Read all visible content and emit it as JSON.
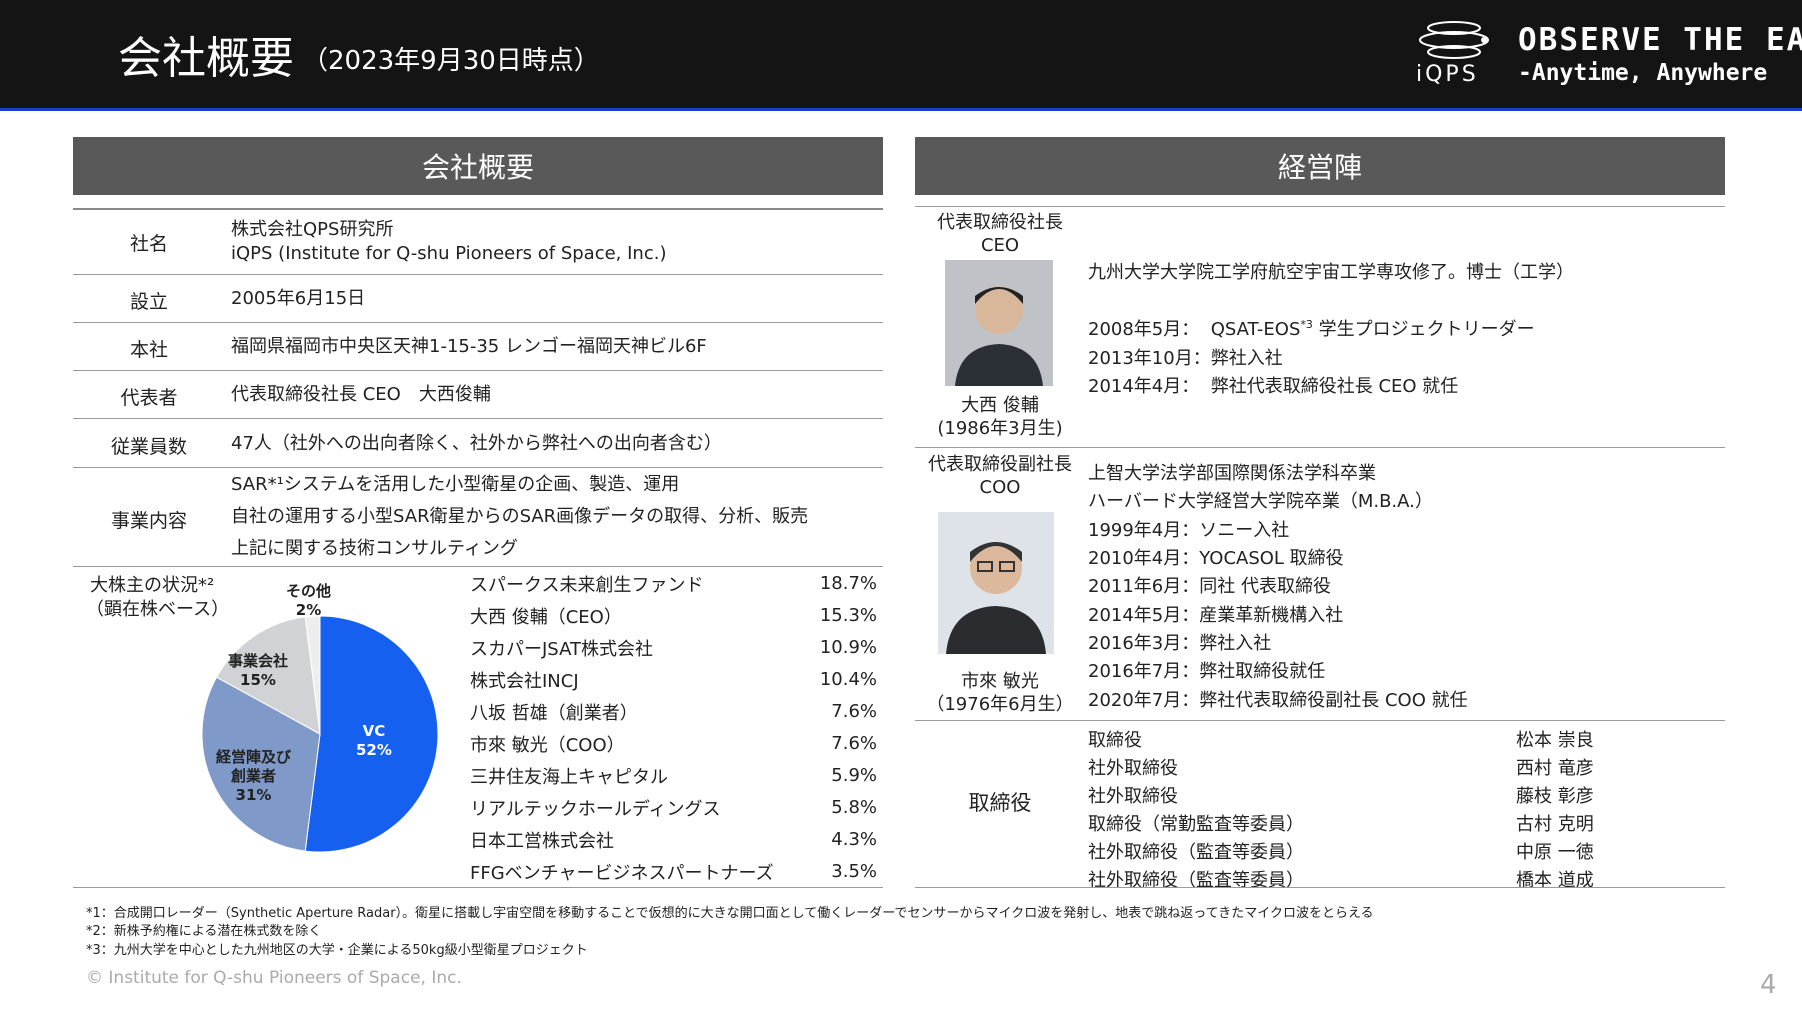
{
  "header": {
    "title": "会社概要",
    "subtitle": "（2023年9月30日時点）",
    "logo_text": "iQPS",
    "slogan_line1": "OBSERVE THE EARTH",
    "slogan_line2": "-Anytime, Anywhere"
  },
  "overview": {
    "heading": "会社概要",
    "rows": [
      {
        "label": "社名",
        "lines": [
          "株式会社QPS研究所",
          "iQPS (Institute for Q-shu Pioneers of Space, Inc.)"
        ]
      },
      {
        "label": "設立",
        "lines": [
          "2005年6月15日"
        ]
      },
      {
        "label": "本社",
        "lines": [
          "福岡県福岡市中央区天神1-15-35 レンゴー福岡天神ビル6F"
        ]
      },
      {
        "label": "代表者",
        "lines": [
          "代表取締役社長 CEO　大西俊輔"
        ]
      },
      {
        "label": "従業員数",
        "lines": [
          "47人（社外への出向者除く、社外から弊社への出向者含む）"
        ]
      },
      {
        "label": "事業内容",
        "lines": [
          "SAR*¹システムを活用した小型衛星の企画、製造、運用",
          "自社の運用する小型SAR衛星からのSAR画像データの取得、分析、販売",
          "上記に関する技術コンサルティング"
        ]
      }
    ]
  },
  "shareholders": {
    "title_line1": "大株主の状況*²",
    "title_line2": "（顕在株ベース）",
    "list": [
      {
        "name": "スパークス未来創生ファンド",
        "pct": "18.7%"
      },
      {
        "name": "大西 俊輔（CEO）",
        "pct": "15.3%"
      },
      {
        "name": "スカパーJSAT株式会社",
        "pct": "10.9%"
      },
      {
        "name": "株式会社INCJ",
        "pct": "10.4%"
      },
      {
        "name": "八坂 哲雄（創業者）",
        "pct": "7.6%"
      },
      {
        "name": "市來 敏光（COO）",
        "pct": "7.6%"
      },
      {
        "name": "三井住友海上キャピタル",
        "pct": "5.9%"
      },
      {
        "name": "リアルテックホールディングス",
        "pct": "5.8%"
      },
      {
        "name": "日本工営株式会社",
        "pct": "4.3%"
      },
      {
        "name": "FFGベンチャービジネスパートナーズ",
        "pct": "3.5%"
      }
    ]
  },
  "chart_data": {
    "type": "pie",
    "slices": [
      {
        "label": "VC",
        "pct_label": "52%",
        "value": 52,
        "color": "#1660f0"
      },
      {
        "label": "経営陣及び\n創業者",
        "pct_label": "31%",
        "value": 31,
        "color": "#7f99c9"
      },
      {
        "label": "事業会社",
        "pct_label": "15%",
        "value": 15,
        "color": "#d0d2d6"
      },
      {
        "label": "その他",
        "pct_label": "2%",
        "value": 2,
        "color": "#eeeeee"
      }
    ]
  },
  "management": {
    "heading": "経営陣",
    "ceo": {
      "role_line1": "代表取締役社長",
      "role_line2": "CEO",
      "name": "大西 俊輔",
      "birth": "(1986年3月生)",
      "bio_line1": "九州大学大学院工学府航空宇宙工学専攻修了。博士（工学）",
      "history": [
        {
          "date": "2008年5月：",
          "text": "QSAT-EOS",
          "sup": "*3",
          "text2": " 学生プロジェクトリーダー"
        },
        {
          "date": "2013年10月：",
          "text": "弊社入社",
          "sup": "",
          "text2": ""
        },
        {
          "date": "2014年4月：",
          "text": "弊社代表取締役社長 CEO 就任",
          "sup": "",
          "text2": ""
        }
      ]
    },
    "coo": {
      "role_line1": "代表取締役副社長",
      "role_line2": "COO",
      "name": "市來 敏光",
      "birth": "（1976年6月生）",
      "bio": [
        "上智大学法学部国際関係法学科卒業",
        "ハーバード大学経営大学院卒業（M.B.A.）",
        "1999年4月：ソニー入社",
        "2010年4月：YOCASOL 取締役",
        "2011年6月：同社 代表取締役",
        "2014年5月：産業革新機構入社",
        "2016年3月：弊社入社",
        "2016年7月：弊社取締役就任",
        "2020年7月：弊社代表取締役副社長 COO 就任"
      ]
    },
    "directors_label": "取締役",
    "directors": [
      {
        "title": "取締役",
        "name": "松本 崇良"
      },
      {
        "title": "社外取締役",
        "name": "西村 竜彦"
      },
      {
        "title": "社外取締役",
        "name": "藤枝 彰彦"
      },
      {
        "title": "取締役（常勤監査等委員）",
        "name": "古村 克明"
      },
      {
        "title": "社外取締役（監査等委員）",
        "name": "中原 一徳"
      },
      {
        "title": "社外取締役（監査等委員）",
        "name": "橋本 道成"
      }
    ]
  },
  "footnotes": [
    "*1：合成開口レーダー（Synthetic Aperture Radar）。衛星に搭載し宇宙空間を移動することで仮想的に大きな開口面として働くレーダーでセンサーからマイクロ波を発射し、地表で跳ね返ってきたマイクロ波をとらえる",
    "*2：新株予約権による潜在株式数を除く",
    "*3：九州大学を中心とした九州地区の大学・企業による50kg級小型衛星プロジェクト"
  ],
  "copyright": "© Institute for Q-shu Pioneers of Space, Inc.",
  "page_number": "4"
}
